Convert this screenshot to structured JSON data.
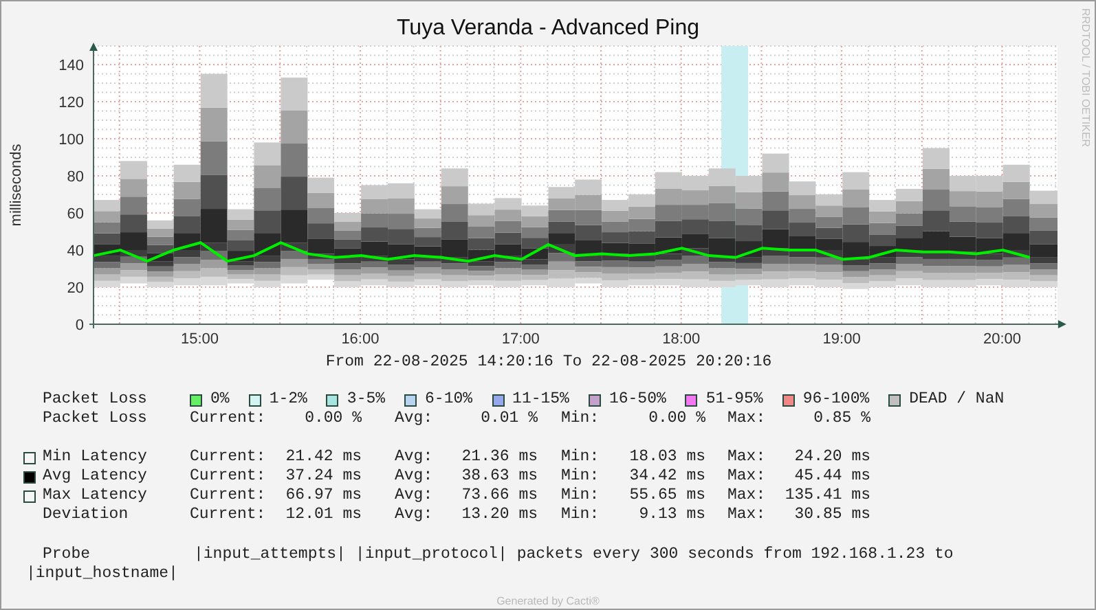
{
  "title": "Tuya Veranda - Advanced Ping",
  "side_label": "RRDTOOL / TOBI OETIKER",
  "chart": {
    "chart_data": {
      "type": "line",
      "ylabel": "milliseconds",
      "x": [
        14.338,
        14.505,
        14.672,
        14.838,
        15.005,
        15.172,
        15.338,
        15.505,
        15.672,
        15.838,
        16.005,
        16.172,
        16.338,
        16.505,
        16.672,
        16.838,
        17.005,
        17.172,
        17.338,
        17.505,
        17.672,
        17.838,
        18.005,
        18.172,
        18.338,
        18.505,
        18.672,
        18.838,
        19.005,
        19.172,
        19.338,
        19.505,
        19.672,
        19.838,
        20.005,
        20.172
      ],
      "series": [
        {
          "values": [
            37,
            40,
            34,
            40,
            44,
            34,
            37,
            44,
            38,
            36,
            37,
            35,
            37,
            36,
            34,
            37,
            35,
            43,
            37,
            38,
            37,
            38,
            41,
            37,
            36,
            41,
            40,
            40,
            35,
            36,
            40,
            39,
            39,
            38,
            40,
            36
          ]
        }
      ],
      "xlim": [
        14.338,
        20.4
      ],
      "ylim": [
        0,
        150
      ],
      "grid": true,
      "xticks": [
        {
          "value": 15,
          "label": "15:00"
        },
        {
          "value": 16,
          "label": "16:00"
        },
        {
          "value": 17,
          "label": "17:00"
        },
        {
          "value": 18,
          "label": "18:00"
        },
        {
          "value": 19,
          "label": "19:00"
        },
        {
          "value": 20,
          "label": "20:00"
        }
      ],
      "yticks": [
        0,
        20,
        40,
        60,
        80,
        100,
        120,
        140
      ]
    }
  },
  "period": "From 22-08-2025 14:20:16 To 22-08-2025 20:20:16",
  "loss_legend": {
    "label": "Packet Loss",
    "items": [
      {
        "label": "0%",
        "color": "#66ee66"
      },
      {
        "label": "1-2%",
        "color": "#d4f4f4"
      },
      {
        "label": "3-5%",
        "color": "#a8e4e0"
      },
      {
        "label": "6-10%",
        "color": "#b8d4f0"
      },
      {
        "label": "11-15%",
        "color": "#98a8ec"
      },
      {
        "label": "16-50%",
        "color": "#c4a0cc"
      },
      {
        "label": "51-95%",
        "color": "#f478f4"
      },
      {
        "label": "96-100%",
        "color": "#f08888"
      },
      {
        "label": "DEAD / NaN",
        "color": "#c0c0c0"
      }
    ]
  },
  "stats": [
    {
      "label": "Packet Loss",
      "cells": [
        {
          "key": "Current:",
          "value": "0.00 %"
        },
        {
          "key": "Avg:",
          "value": "0.01 %"
        },
        {
          "key": "Min:",
          "value": "0.00 %"
        },
        {
          "key": "Max:",
          "value": "0.85 %"
        }
      ]
    },
    {
      "kind": "gap"
    },
    {
      "label": "Min Latency",
      "color": "#f5f5f5",
      "cells": [
        {
          "key": "Current:",
          "value": "21.42 ms"
        },
        {
          "key": "Avg:",
          "value": "21.36 ms"
        },
        {
          "key": "Min:",
          "value": "18.03 ms"
        },
        {
          "key": "Max:",
          "value": "24.20 ms"
        }
      ]
    },
    {
      "label": "Avg Latency",
      "color": "#000000",
      "cells": [
        {
          "key": "Current:",
          "value": "37.24 ms"
        },
        {
          "key": "Avg:",
          "value": "38.63 ms"
        },
        {
          "key": "Min:",
          "value": "34.42 ms"
        },
        {
          "key": "Max:",
          "value": "45.44 ms"
        }
      ]
    },
    {
      "label": "Max Latency",
      "color": "#f5f5f5",
      "cells": [
        {
          "key": "Current:",
          "value": "66.97 ms"
        },
        {
          "key": "Avg:",
          "value": "73.66 ms"
        },
        {
          "key": "Min:",
          "value": "55.65 ms"
        },
        {
          "key": "Max:",
          "value": "135.41 ms"
        }
      ]
    },
    {
      "label": "Deviation",
      "cells": [
        {
          "key": "Current:",
          "value": "12.01 ms"
        },
        {
          "key": "Avg:",
          "value": "13.20 ms"
        },
        {
          "key": "Min:",
          "value": "9.13 ms"
        },
        {
          "key": "Max:",
          "value": "30.85 ms"
        }
      ]
    }
  ],
  "probe": {
    "label": "Probe",
    "parts": [
      "|input_attempts|",
      "|input_protocol|",
      "packets every 300 seconds from 192.168.1.23 to"
    ],
    "continuation": "|input_hostname|"
  },
  "footer": "Generated by Cacti®"
}
